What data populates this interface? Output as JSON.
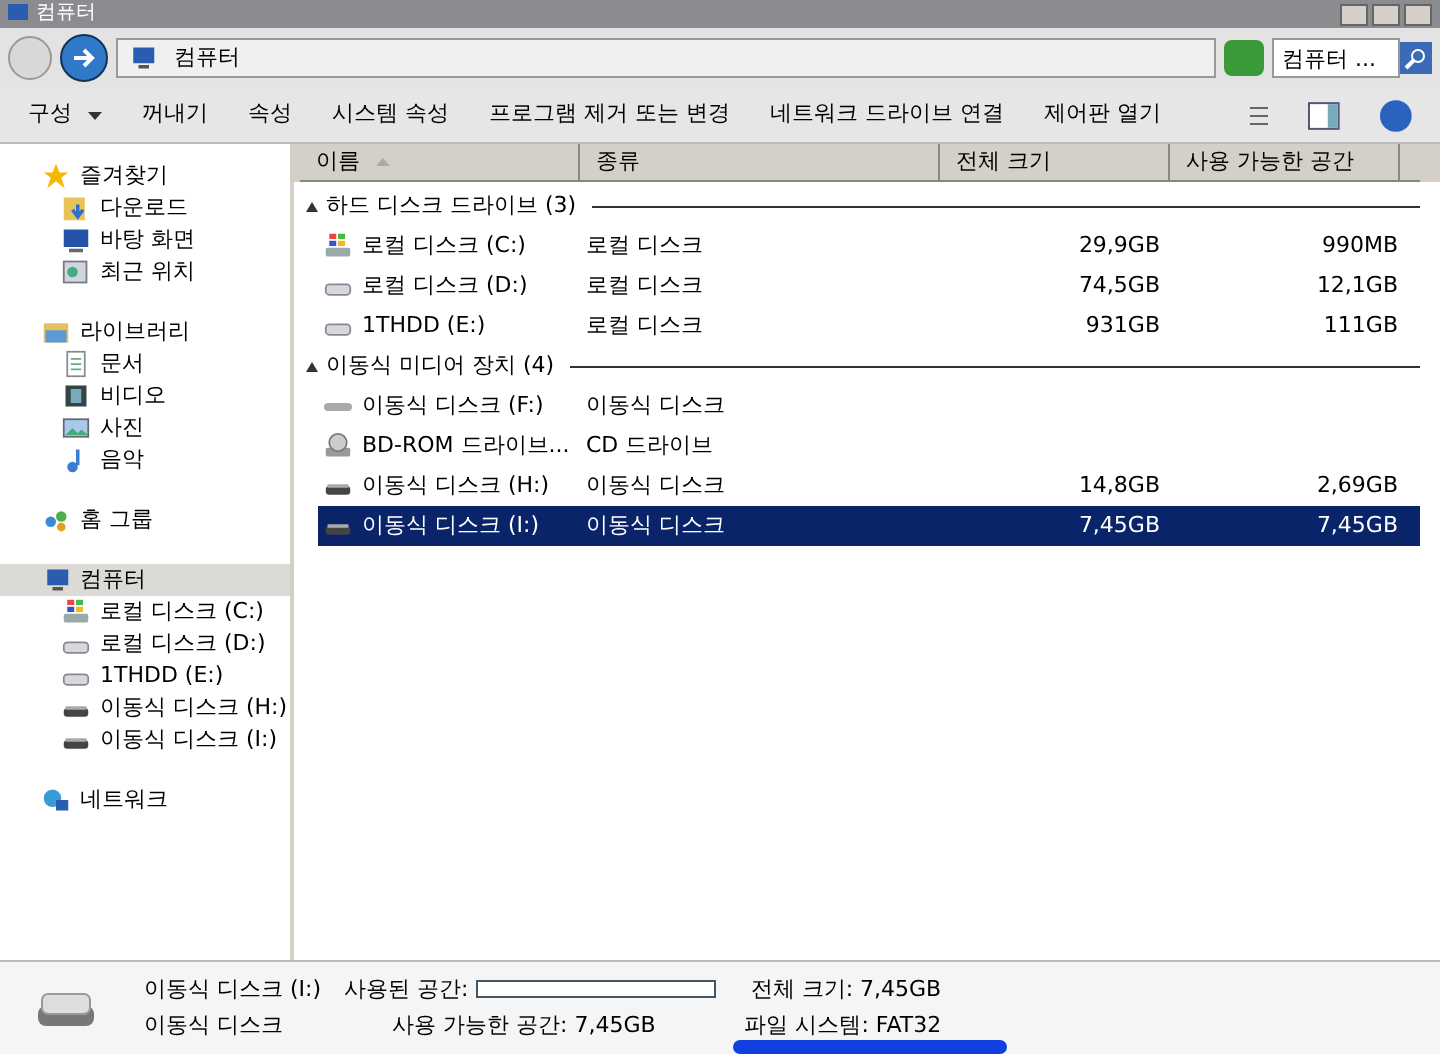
{
  "window": {
    "title": "컴퓨터"
  },
  "address": {
    "path": "컴퓨터",
    "search_placeholder": "컴퓨터 ..."
  },
  "toolbar": [
    {
      "label": "구성",
      "dropdown": true
    },
    {
      "label": "꺼내기",
      "dropdown": false
    },
    {
      "label": "속성",
      "dropdown": false
    },
    {
      "label": "시스템 속성",
      "dropdown": false
    },
    {
      "label": "프로그램 제거 또는 변경",
      "dropdown": false
    },
    {
      "label": "네트워크 드라이브 연결",
      "dropdown": false
    },
    {
      "label": "제어판 열기",
      "dropdown": false
    }
  ],
  "sidebar": [
    {
      "label": "즐겨찾기",
      "kind": "star",
      "selected": false,
      "children": [
        {
          "label": "다운로드",
          "kind": "download"
        },
        {
          "label": "바탕 화면",
          "kind": "desktop"
        },
        {
          "label": "최근 위치",
          "kind": "recent"
        }
      ]
    },
    {
      "label": "라이브러리",
      "kind": "library",
      "selected": false,
      "children": [
        {
          "label": "문서",
          "kind": "document"
        },
        {
          "label": "비디오",
          "kind": "video"
        },
        {
          "label": "사진",
          "kind": "photo"
        },
        {
          "label": "음악",
          "kind": "music"
        }
      ]
    },
    {
      "label": "홈 그룹",
      "kind": "homegroup",
      "selected": false
    },
    {
      "label": "컴퓨터",
      "kind": "computer",
      "selected": true,
      "children": [
        {
          "label": "로컬 디스크 (C:)",
          "kind": "system"
        },
        {
          "label": "로컬 디스크 (D:)",
          "kind": "hdd"
        },
        {
          "label": "1THDD (E:)",
          "kind": "hdd"
        },
        {
          "label": "이동식 디스크 (H:)",
          "kind": "removable"
        },
        {
          "label": "이동식 디스크 (I:)",
          "kind": "removable"
        }
      ]
    },
    {
      "label": "네트워크",
      "kind": "network",
      "selected": false
    }
  ],
  "table": {
    "columns": [
      {
        "label": "이름",
        "sorted": true
      },
      {
        "label": "종류",
        "sorted": false
      },
      {
        "label": "전체 크기",
        "sorted": false
      },
      {
        "label": "사용 가능한 공간",
        "sorted": false
      }
    ],
    "groups": [
      {
        "title": "하드 디스크 드라이브 (3)",
        "expanded": true,
        "rows": [
          {
            "name": "로컬 디스크 (C:)",
            "kind": "system",
            "type": "로컬 디스크",
            "total": "29,9GB",
            "free": "990MB",
            "selected": false
          },
          {
            "name": "로컬 디스크 (D:)",
            "kind": "hdd",
            "type": "로컬 디스크",
            "total": "74,5GB",
            "free": "12,1GB",
            "selected": false
          },
          {
            "name": "1THDD (E:)",
            "kind": "hdd",
            "type": "로컬 디스크",
            "total": "931GB",
            "free": "111GB",
            "selected": false
          }
        ]
      },
      {
        "title": "이동식 미디어 장치 (4)",
        "expanded": true,
        "rows": [
          {
            "name": "이동식 디스크 (F:)",
            "kind": "removable_empty",
            "type": "이동식 디스크",
            "selected": false
          },
          {
            "name": "BD-ROM 드라이브...",
            "kind": "optical",
            "type": "CD 드라이브",
            "selected": false
          },
          {
            "name": "이동식 디스크 (H:)",
            "kind": "removable",
            "type": "이동식 디스크",
            "total": "14,8GB",
            "free": "2,69GB",
            "selected": false
          },
          {
            "name": "이동식 디스크 (I:)",
            "kind": "removable",
            "type": "이동식 디스크",
            "total": "7,45GB",
            "free": "7,45GB",
            "selected": true
          }
        ]
      }
    ]
  },
  "details": {
    "name": "이동식 디스크 (I:)",
    "type": "이동식 디스크",
    "used_label": "사용된 공간:",
    "level": 0,
    "free": "사용 가능한 공간: 7,45GB",
    "total": "전체 크기: 7,45GB",
    "filesystem": "파일 시스템: FAT32"
  }
}
